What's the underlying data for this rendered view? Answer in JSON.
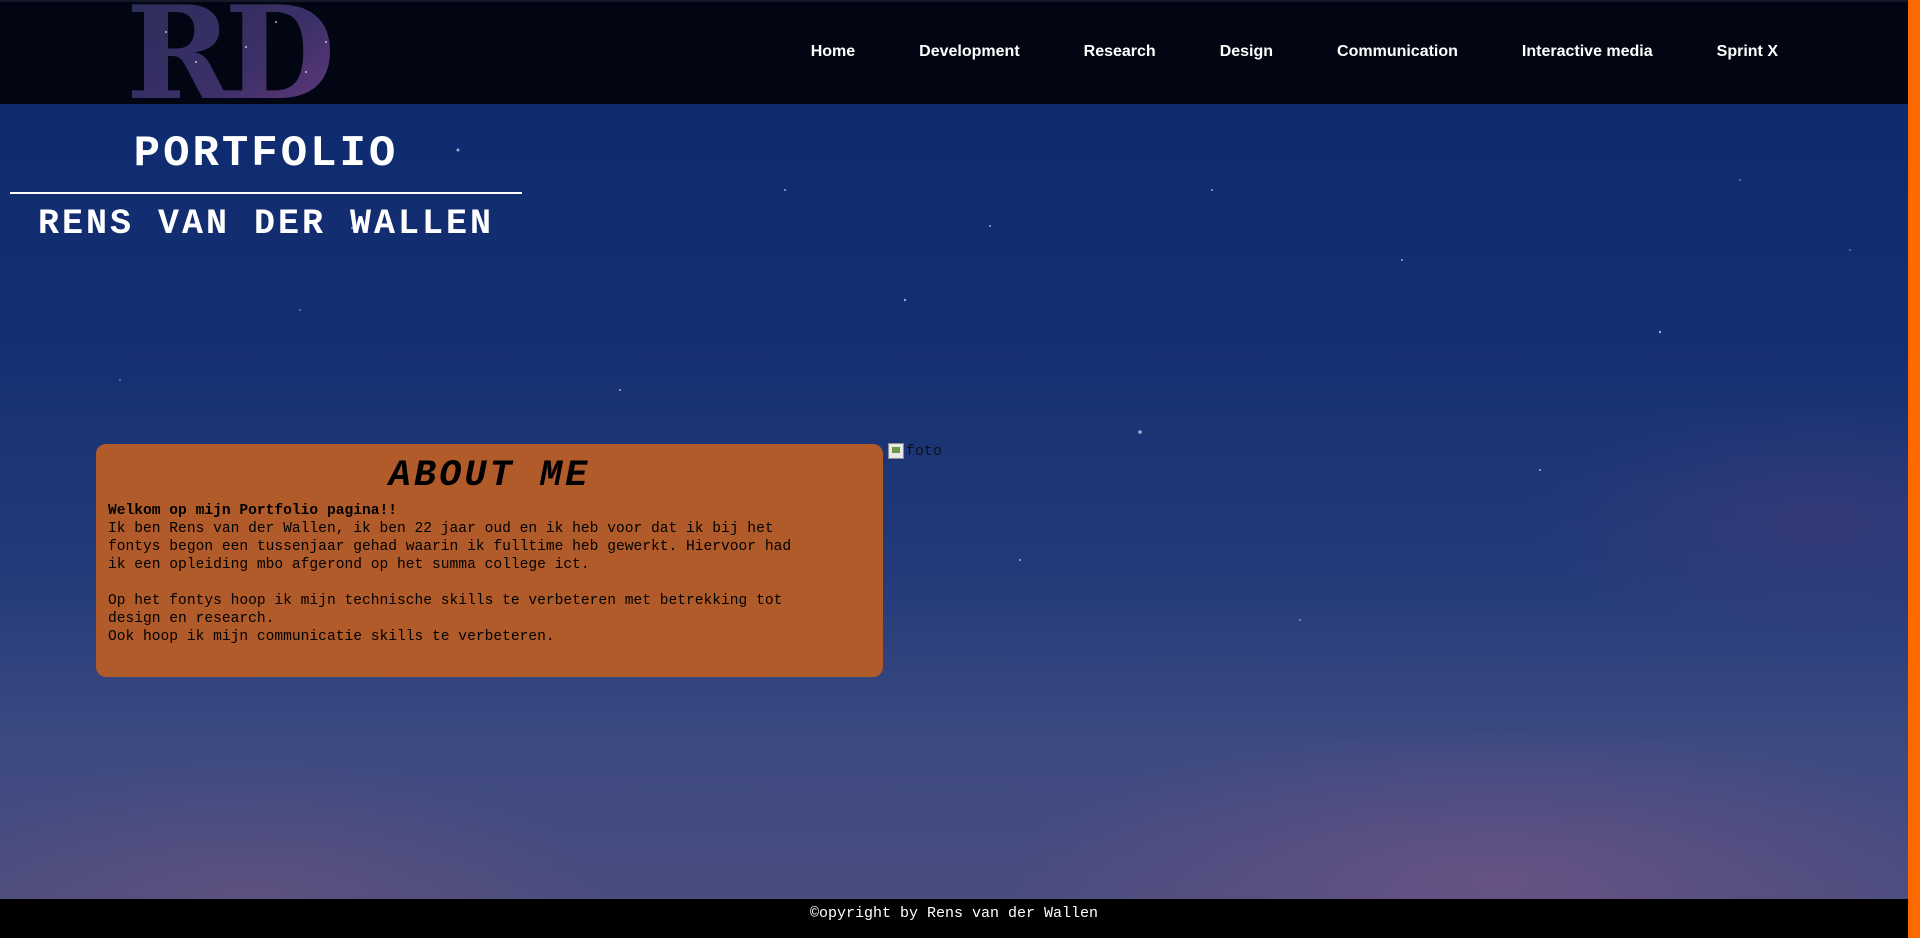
{
  "header": {
    "logo_text": "RD",
    "nav": [
      {
        "label": "Home"
      },
      {
        "label": "Development"
      },
      {
        "label": "Research"
      },
      {
        "label": "Design"
      },
      {
        "label": "Communication"
      },
      {
        "label": "Interactive media"
      },
      {
        "label": "Sprint X"
      }
    ]
  },
  "hero": {
    "title": "PORTFOLIO",
    "subtitle": "RENS VAN DER WALLEN"
  },
  "about": {
    "heading": "ABOUT ME",
    "welcome": "Welkom op mijn Portfolio pagina!!",
    "paragraph1_line1": "Ik ben Rens van der Wallen, ik ben 22 jaar oud en ik heb voor dat ik bij het",
    "paragraph1_line2": "fontys begon een tussenjaar gehad waarin ik fulltime heb gewerkt. Hiervoor had",
    "paragraph1_line3": "ik een opleiding mbo afgerond op het summa college ict.",
    "paragraph2_line1": "Op het fontys hoop ik mijn technische skills te verbeteren met betrekking tot",
    "paragraph2_line2": "design en research.",
    "paragraph3": "Ook hoop ik mijn communicatie skills te verbeteren."
  },
  "photo": {
    "alt": "foto"
  },
  "footer": {
    "copyright": "©opyright by Rens van der Wallen"
  },
  "colors": {
    "about_bg": "#b15b2a",
    "topbar_bg": "#020613",
    "scrollbar": "#ff6a00"
  }
}
